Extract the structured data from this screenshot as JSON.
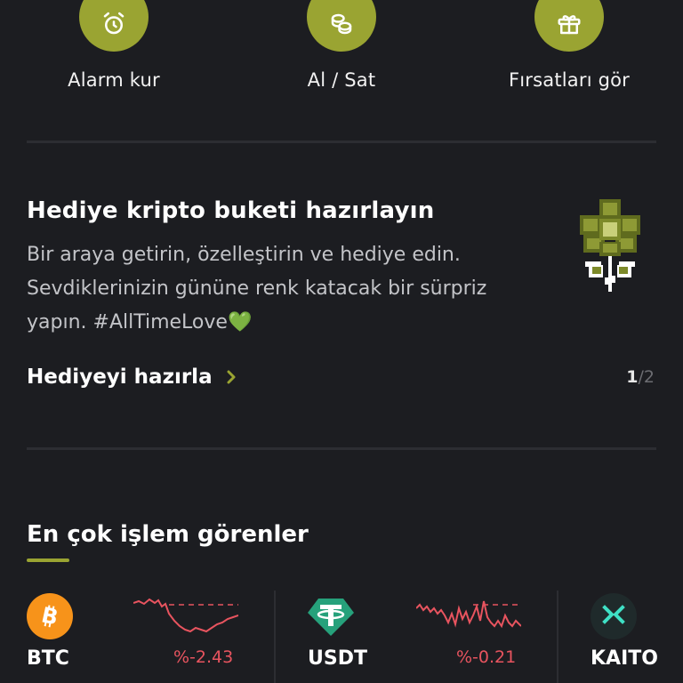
{
  "quick_actions": [
    {
      "label": "Alarm kur",
      "icon": "alarm-clock-icon"
    },
    {
      "label": "Al / Sat",
      "icon": "coins-icon"
    },
    {
      "label": "Fırsatları gör",
      "icon": "gift-icon"
    }
  ],
  "promo": {
    "title": "Hediye kripto buketi hazırlayın",
    "description": "Bir araya getirin, özelleştirin ve hediye edin. Sevdiklerinizin gününe renk katacak bir sürpriz yapın. #AllTimeLove",
    "emoji": "💚",
    "cta": "Hediyeyi hazırla",
    "page_current": "1",
    "page_separator": "/",
    "page_total": "2",
    "image": "pixel-flower-icon"
  },
  "top_traded": {
    "title": "En çok işlem görenler",
    "coins": [
      {
        "symbol": "BTC",
        "change": "%-2.43",
        "icon": "bitcoin-icon"
      },
      {
        "symbol": "USDT",
        "change": "%-0.21",
        "icon": "tether-icon"
      },
      {
        "symbol": "KAITO",
        "change": "",
        "icon": "kaito-icon"
      }
    ]
  },
  "colors": {
    "background": "#1c1d21",
    "accent": "#9aa432",
    "negative": "#e8545f",
    "heart": "#2ec84b"
  }
}
